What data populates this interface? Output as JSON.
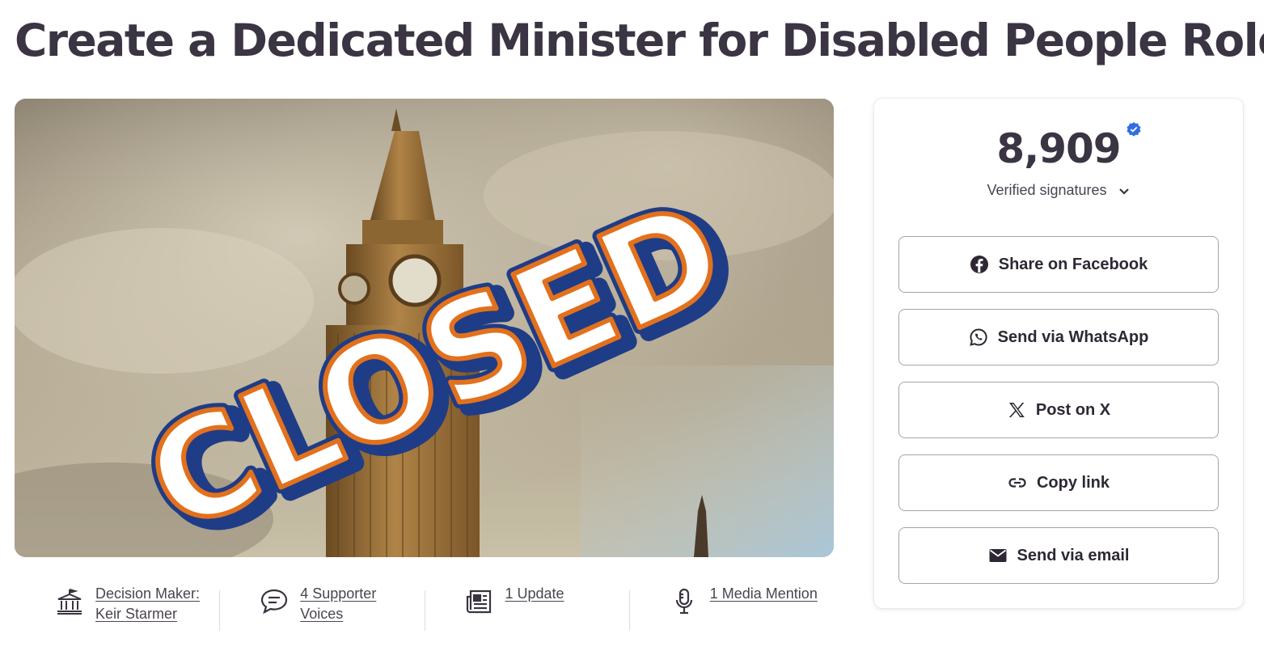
{
  "page": {
    "title": "Create a Dedicated Minister for Disabled People Role"
  },
  "hero": {
    "overlay_text": "CLOSED",
    "icon": "big-ben-photo"
  },
  "stats": [
    {
      "icon": "government-building-icon",
      "label": "Decision Maker: Keir Starmer"
    },
    {
      "icon": "speech-bubble-icon",
      "label": "4 Supporter Voices"
    },
    {
      "icon": "newspaper-icon",
      "label": "1 Update"
    },
    {
      "icon": "microphone-icon",
      "label": "1 Media Mention"
    }
  ],
  "signatures": {
    "count": "8,909",
    "label": "Verified signatures",
    "badge_icon": "verified-check-icon"
  },
  "share": [
    {
      "icon": "facebook-icon",
      "label": "Share on Facebook"
    },
    {
      "icon": "whatsapp-icon",
      "label": "Send via WhatsApp"
    },
    {
      "icon": "x-logo-icon",
      "label": "Post on X"
    },
    {
      "icon": "link-icon",
      "label": "Copy link"
    },
    {
      "icon": "email-icon",
      "label": "Send via email"
    }
  ],
  "colors": {
    "text_dark": "#3b3443",
    "verified_blue": "#2f6fe0",
    "closed_fill": "#ffffff",
    "closed_outline_orange": "#e2711d",
    "closed_shadow_navy": "#1f3c86"
  }
}
